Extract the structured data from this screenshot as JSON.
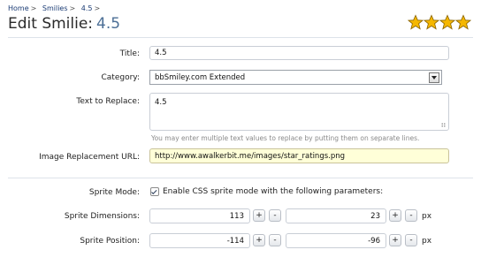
{
  "breadcrumb": [
    {
      "label": "Home"
    },
    {
      "label": "Smilies"
    },
    {
      "label": "4.5"
    }
  ],
  "breadcrumb_separator": ">",
  "page_title": {
    "prefix": "Edit Smilie:",
    "value": "4.5"
  },
  "smilie_image": {
    "icon": "star-rating-icon",
    "stars": 4.5,
    "max_stars": 5,
    "color": "#f5b700"
  },
  "form": {
    "title": {
      "label": "Title:",
      "value": "4.5"
    },
    "category": {
      "label": "Category:",
      "value": "bbSmiley.com Extended"
    },
    "text_to_replace": {
      "label": "Text to Replace:",
      "value": "4.5",
      "hint": "You may enter multiple text values to replace by putting them on separate lines."
    },
    "image_url": {
      "label": "Image Replacement URL:",
      "value": "http://www.awalkerbit.me/images/star_ratings.png"
    },
    "sprite_mode": {
      "label": "Sprite Mode:",
      "checked": true,
      "checkbox_label": "Enable CSS sprite mode with the following parameters:"
    },
    "sprite_dimensions": {
      "label": "Sprite Dimensions:",
      "width": "113",
      "height": "23",
      "unit": "px"
    },
    "sprite_position": {
      "label": "Sprite Position:",
      "x": "-114",
      "y": "-96",
      "unit": "px"
    },
    "plus_label": "+",
    "minus_label": "-"
  },
  "colors": {
    "link": "#1a3b74",
    "title_value": "#4c6f96",
    "highlight_field": "#ffffd8"
  }
}
